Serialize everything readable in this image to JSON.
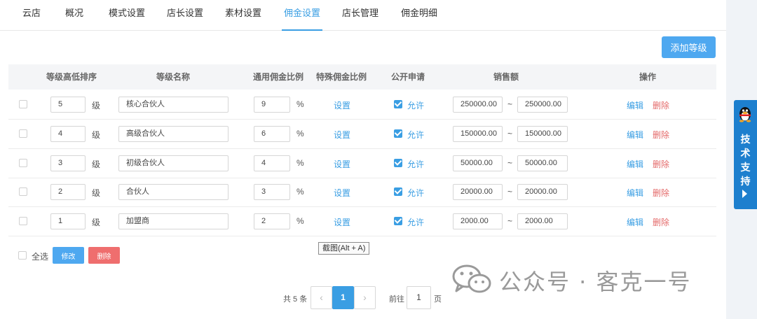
{
  "tabs": [
    {
      "label": "云店"
    },
    {
      "label": "概况"
    },
    {
      "label": "模式设置"
    },
    {
      "label": "店长设置"
    },
    {
      "label": "素材设置"
    },
    {
      "label": "佣金设置",
      "active": true
    },
    {
      "label": "店长管理"
    },
    {
      "label": "佣金明细"
    }
  ],
  "add_level_label": "添加等级",
  "table": {
    "headers": [
      "等级高低排序",
      "等级名称",
      "通用佣金比例",
      "特殊佣金比例",
      "公开申请",
      "销售额",
      "操作"
    ],
    "level_unit": "级",
    "percent_unit": "%",
    "range_sep": "~",
    "special_label": "设置",
    "allow_label": "允许",
    "edit_label": "编辑",
    "delete_label": "删除",
    "rows": [
      {
        "level": "5",
        "name": "核心合伙人",
        "rate": "9",
        "sales_min": "250000.00",
        "sales_max": "250000.00",
        "allow": true
      },
      {
        "level": "4",
        "name": "高级合伙人",
        "rate": "6",
        "sales_min": "150000.00",
        "sales_max": "150000.00",
        "allow": true
      },
      {
        "level": "3",
        "name": "初级合伙人",
        "rate": "4",
        "sales_min": "50000.00",
        "sales_max": "50000.00",
        "allow": true
      },
      {
        "level": "2",
        "name": "合伙人",
        "rate": "3",
        "sales_min": "20000.00",
        "sales_max": "20000.00",
        "allow": true
      },
      {
        "level": "1",
        "name": "加盟商",
        "rate": "2",
        "sales_min": "2000.00",
        "sales_max": "2000.00",
        "allow": true
      }
    ]
  },
  "bulk": {
    "select_all_label": "全选",
    "edit_label": "修改",
    "delete_label": "删除"
  },
  "tooltip": "截图(Alt + A)",
  "pagination": {
    "total_label": "共 5 条",
    "prev_icon": "‹",
    "current_page": "1",
    "next_icon": "›",
    "goto_label": "前往",
    "goto_value": "1",
    "page_unit": "页"
  },
  "support": {
    "chars": [
      "技",
      "术",
      "支",
      "持"
    ]
  },
  "watermark": {
    "text": "公众号 · 客克一号"
  },
  "colors": {
    "accent": "#3a9ee3",
    "button_blue": "#4ea8f0",
    "danger": "#ef6e6e",
    "support_blue": "#1d7fce"
  }
}
